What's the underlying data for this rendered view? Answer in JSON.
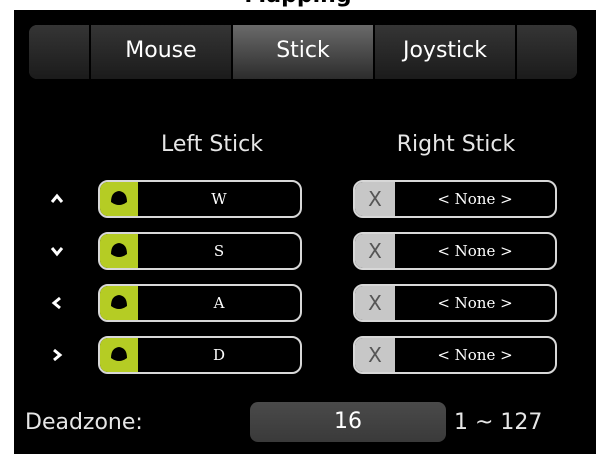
{
  "title": "...pping...",
  "tabs": [
    {
      "label": "Mouse",
      "active": false
    },
    {
      "label": "Stick",
      "active": true
    },
    {
      "label": "Joystick",
      "active": false
    }
  ],
  "left_stick": {
    "heading": "Left Stick",
    "rows": [
      {
        "direction": "up",
        "icon": "chevron-up-icon",
        "key": "W"
      },
      {
        "direction": "down",
        "icon": "chevron-down-icon",
        "key": "S"
      },
      {
        "direction": "left",
        "icon": "chevron-left-icon",
        "key": "A"
      },
      {
        "direction": "right",
        "icon": "chevron-right-icon",
        "key": "D"
      }
    ]
  },
  "right_stick": {
    "heading": "Right Stick",
    "clear_label": "X",
    "rows": [
      {
        "value": "< None >"
      },
      {
        "value": "< None >"
      },
      {
        "value": "< None >"
      },
      {
        "value": "< None >"
      }
    ]
  },
  "deadzone": {
    "label": "Deadzone:",
    "value": "16",
    "range": "1 ~ 127"
  },
  "colors": {
    "accent": "#b5cc24",
    "panel": "#000000",
    "tab_active": "#5a5a5a"
  }
}
